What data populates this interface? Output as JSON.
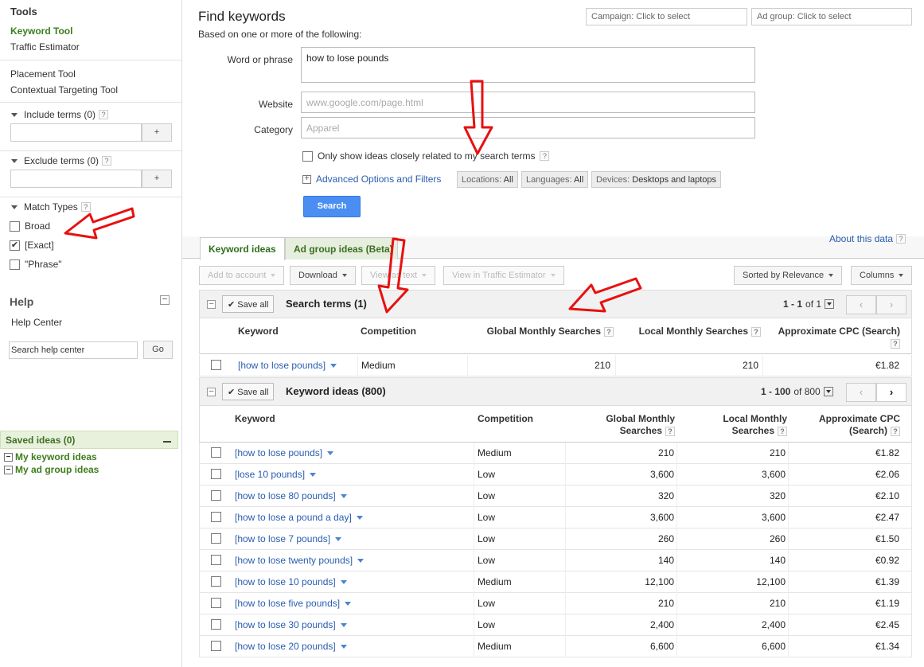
{
  "sidebar": {
    "tools_title": "Tools",
    "keyword_tool": "Keyword Tool",
    "traffic_estimator": "Traffic Estimator",
    "placement_tool": "Placement Tool",
    "contextual_tool": "Contextual Targeting Tool",
    "include_terms": "Include terms (0)",
    "exclude_terms": "Exclude terms (0)",
    "plus": "+",
    "qmark": "?",
    "match_types": "Match Types",
    "match": [
      {
        "label": "Broad",
        "checked": false
      },
      {
        "label": "[Exact]",
        "checked": true
      },
      {
        "label": "\"Phrase\"",
        "checked": false
      }
    ],
    "help_title": "Help",
    "help_center": "Help Center",
    "help_search_value": "Search help center",
    "go": "Go",
    "saved_ideas": "Saved ideas (0)",
    "my_keyword_ideas": "My keyword ideas",
    "my_ad_group_ideas": "My ad group ideas"
  },
  "main": {
    "title": "Find keywords",
    "subtitle": "Based on one or more of the following:",
    "campaign_select": "Campaign: Click to select",
    "adgroup_select": "Ad group: Click to select",
    "word_label": "Word or phrase",
    "word_value": "how to lose pounds",
    "website_label": "Website",
    "website_placeholder": "www.google.com/page.html",
    "category_label": "Category",
    "category_placeholder": "Apparel",
    "only_show": "Only show ideas closely related to my search terms",
    "advanced": "Advanced Options and Filters",
    "locations_label": "Locations:",
    "locations_value": "All",
    "languages_label": "Languages:",
    "languages_value": "All",
    "devices_label": "Devices:",
    "devices_value": "Desktops and laptops",
    "search_button": "Search"
  },
  "tabs": {
    "keyword_ideas": "Keyword ideas",
    "ad_group_ideas": "Ad group ideas (Beta)",
    "about": "About this data"
  },
  "toolbar": {
    "add_to_account": "Add to account",
    "download": "Download",
    "view_as_text": "View as text",
    "view_traffic": "View in Traffic Estimator",
    "sorted": "Sorted by Relevance",
    "columns": "Columns"
  },
  "search_terms": {
    "save_all": "Save all",
    "title": "Search terms (1)",
    "pager_range": "1 - 1",
    "pager_of": "of 1",
    "headers": {
      "keyword": "Keyword",
      "competition": "Competition",
      "global": "Global Monthly Searches",
      "local": "Local Monthly Searches",
      "cpc": "Approximate CPC (Search)"
    },
    "rows": [
      {
        "keyword": "[how to lose pounds]",
        "competition": "Medium",
        "global": "210",
        "local": "210",
        "cpc": "€1.82"
      }
    ]
  },
  "keyword_ideas": {
    "save_all": "Save all",
    "title": "Keyword ideas (800)",
    "pager_range": "1 - 100",
    "pager_of": "of 800",
    "headers": {
      "keyword": "Keyword",
      "competition": "Competition",
      "global_1": "Global Monthly",
      "global_2": "Searches",
      "local_1": "Local Monthly",
      "local_2": "Searches",
      "cpc_1": "Approximate CPC",
      "cpc_2": "(Search)"
    },
    "rows": [
      {
        "keyword": "[how to lose pounds]",
        "competition": "Medium",
        "global": "210",
        "local": "210",
        "cpc": "€1.82"
      },
      {
        "keyword": "[lose 10 pounds]",
        "competition": "Low",
        "global": "3,600",
        "local": "3,600",
        "cpc": "€2.06"
      },
      {
        "keyword": "[how to lose 80 pounds]",
        "competition": "Low",
        "global": "320",
        "local": "320",
        "cpc": "€2.10"
      },
      {
        "keyword": "[how to lose a pound a day]",
        "competition": "Low",
        "global": "3,600",
        "local": "3,600",
        "cpc": "€2.47"
      },
      {
        "keyword": "[how to lose 7 pounds]",
        "competition": "Low",
        "global": "260",
        "local": "260",
        "cpc": "€1.50"
      },
      {
        "keyword": "[how to lose twenty pounds]",
        "competition": "Low",
        "global": "140",
        "local": "140",
        "cpc": "€0.92"
      },
      {
        "keyword": "[how to lose 10 pounds]",
        "competition": "Medium",
        "global": "12,100",
        "local": "12,100",
        "cpc": "€1.39"
      },
      {
        "keyword": "[how to lose five pounds]",
        "competition": "Low",
        "global": "210",
        "local": "210",
        "cpc": "€1.19"
      },
      {
        "keyword": "[how to lose 30 pounds]",
        "competition": "Low",
        "global": "2,400",
        "local": "2,400",
        "cpc": "€2.45"
      },
      {
        "keyword": "[how to lose 20 pounds]",
        "competition": "Medium",
        "global": "6,600",
        "local": "6,600",
        "cpc": "€1.34"
      }
    ]
  },
  "colors": {
    "link": "#2a5db0",
    "active_green": "#3a7d1b",
    "search_blue": "#4b8ef1",
    "annotation_red": "#e81010"
  }
}
